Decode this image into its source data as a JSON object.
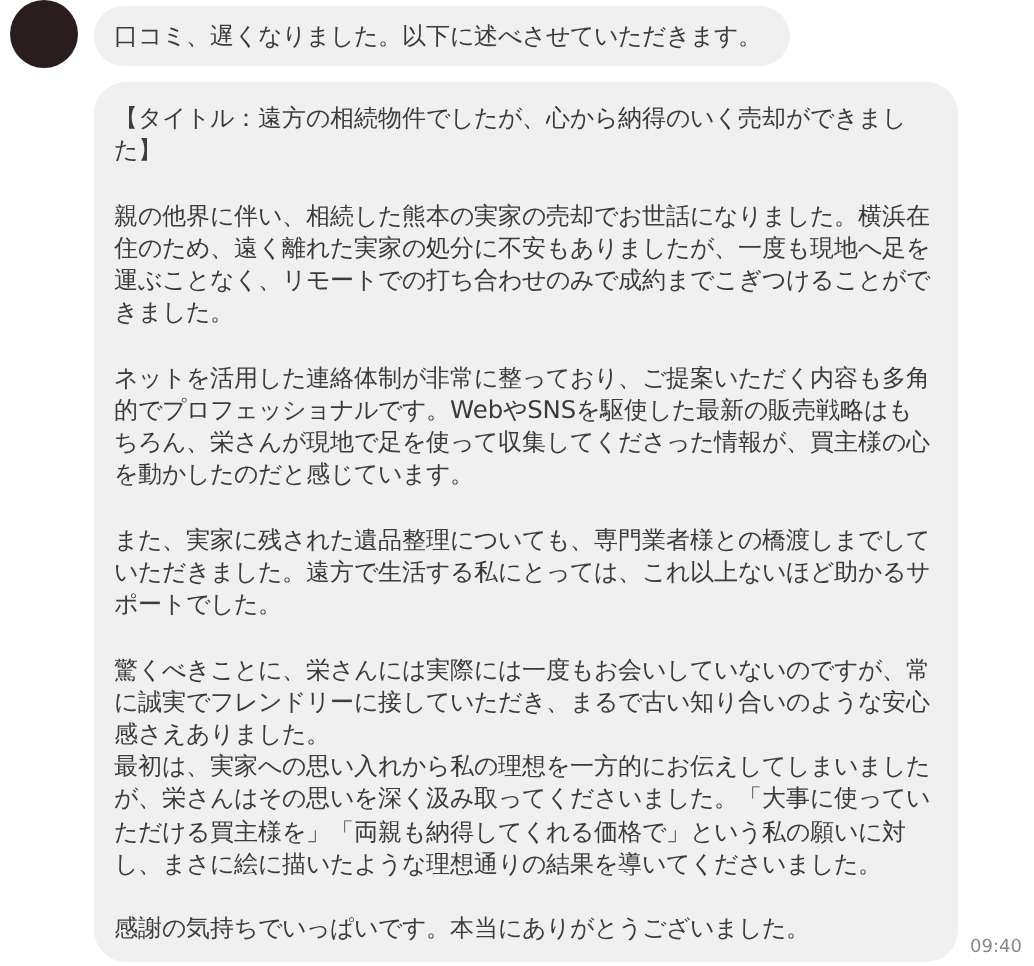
{
  "messages": [
    {
      "text_blocks": [
        [
          "口コミ、遅くなりました。以下に述べさせていただきます。"
        ]
      ]
    },
    {
      "text_blocks": [
        [
          "【タイトル：遠方の相続物件でしたが、心から納得のいく売却ができました】"
        ],
        [
          "親の他界に伴い、相続した熊本の実家の売却でお世話になりました。横浜在住のため、遠く離れた実家の処分に不安もありましたが、一度も現地へ足を運ぶことなく、リモートでの打ち合わせのみで成約までこぎつけることができました。"
        ],
        [
          "ネットを活用した連絡体制が非常に整っており、ご提案いただく内容も多角的でプロフェッショナルです。WebやSNSを駆使した最新の販売戦略はもちろん、栄さんが現地で足を使って収集してくださった情報が、買主様の心を動かしたのだと感じています。"
        ],
        [
          "また、実家に残された遺品整理についても、専門業者様との橋渡しまでしていただきました。遠方で生活する私にとっては、これ以上ないほど助かるサポートでした。"
        ],
        [
          "驚くべきことに、栄さんには実際には一度もお会いしていないのですが、常に誠実でフレンドリーに接していただき、まるで古い知り合いのような安心感さえありました。",
          "最初は、実家への思い入れから私の理想を一方的にお伝えしてしまいましたが、栄さんはその思いを深く汲み取ってくださいました。「大事に使っていただける買主様を」「両親も納得してくれる価格で」という私の願いに対し、まさに絵に描いたような理想通りの結果を導いてくださいました。"
        ],
        [
          "感謝の気持ちでいっぱいです。本当にありがとうございました。"
        ]
      ],
      "time": "09:40"
    }
  ]
}
